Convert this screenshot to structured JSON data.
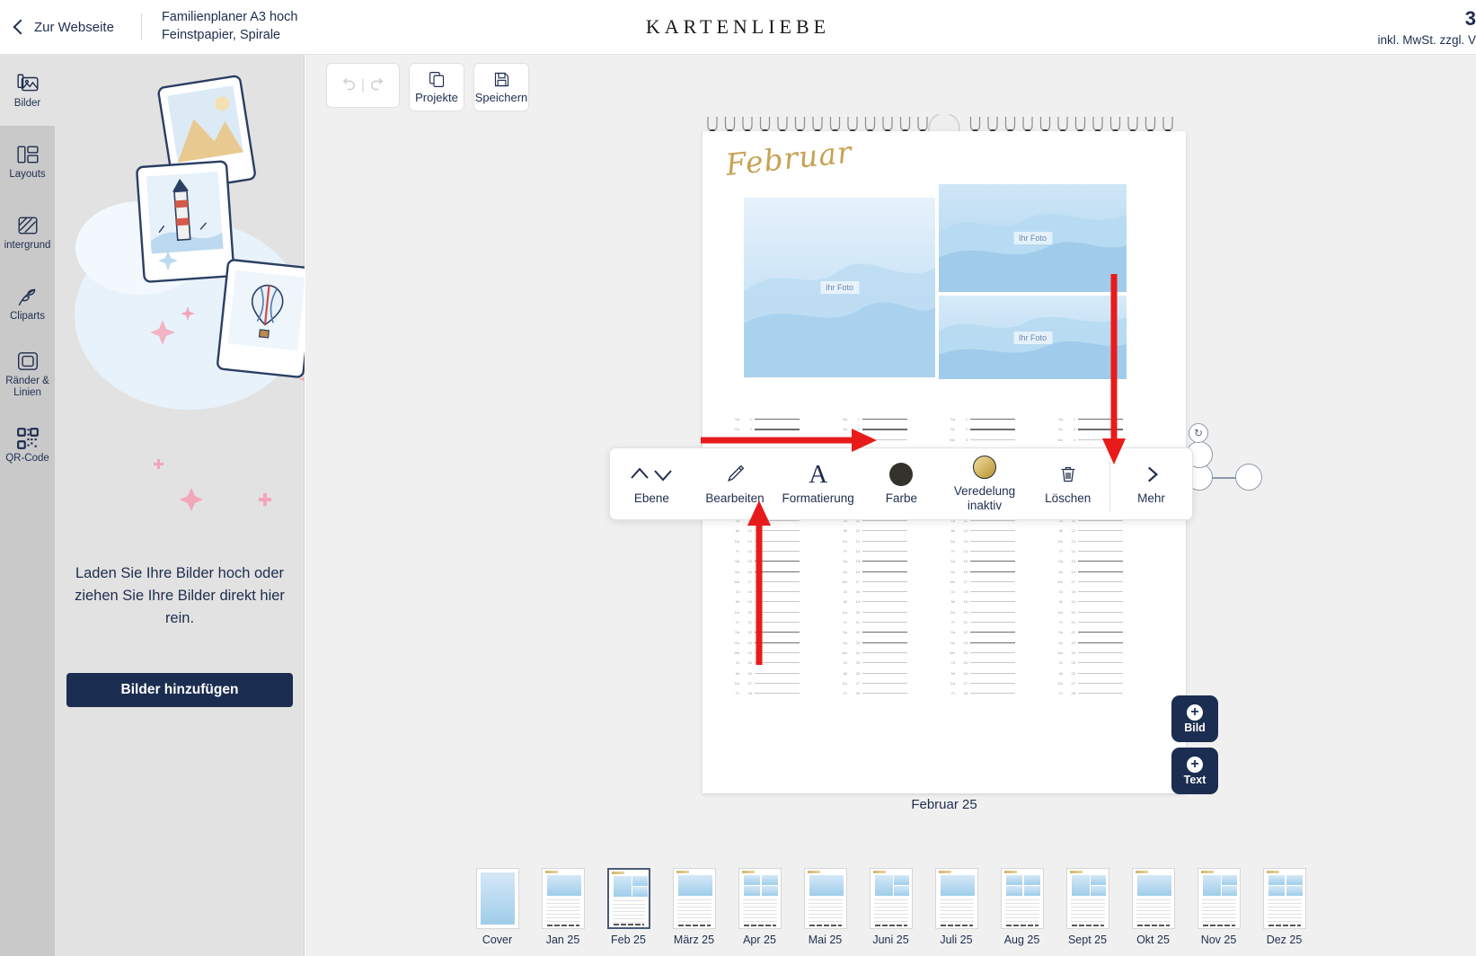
{
  "header": {
    "back_label": "Zur Webseite",
    "product_title": "Familienplaner A3 hoch",
    "product_sub": "Feinstpapier, Spirale",
    "brand": "KARTENLIEBE",
    "price": "3",
    "price_note": "inkl. MwSt. zzgl. V"
  },
  "sidebar": {
    "items": [
      {
        "label": "Bilder",
        "icon": "image-icon",
        "active": true
      },
      {
        "label": "Layouts",
        "icon": "layouts-icon",
        "active": false
      },
      {
        "label": "intergrund",
        "icon": "background-icon",
        "active": false
      },
      {
        "label": "Cliparts",
        "icon": "clipart-icon",
        "active": false
      },
      {
        "label": "Ränder &\nLinien",
        "icon": "borders-icon",
        "active": false
      },
      {
        "label": "QR-Code",
        "icon": "qrcode-icon",
        "active": false
      }
    ]
  },
  "panel": {
    "dropzone_text": "Laden Sie Ihre Bilder hoch oder ziehen Sie Ihre Bilder direkt hier rein.",
    "add_button": "Bilder hinzufügen"
  },
  "toolbar": {
    "undo": "undo-icon",
    "redo": "redo-icon",
    "projects_label": "Projekte",
    "save_label": "Speichern"
  },
  "canvas": {
    "month_title": "Februar",
    "page_caption": "Februar 25",
    "photo_placeholder": "Ihr Foto",
    "photo_count": 3,
    "fab_image": "Bild",
    "fab_text": "Text"
  },
  "context_menu": {
    "items": [
      {
        "name": "ebene",
        "label": "Ebene",
        "icon": "chevron-up-down-icon"
      },
      {
        "name": "bearbeiten",
        "label": "Bearbeiten",
        "icon": "pencil-icon"
      },
      {
        "name": "formatierung",
        "label": "Formatierung",
        "icon": "letter-a-icon"
      },
      {
        "name": "farbe",
        "label": "Farbe",
        "icon": "color-swatch-dark"
      },
      {
        "name": "veredelung",
        "label": "Veredelung",
        "sublabel": "inaktiv",
        "icon": "color-swatch-gold"
      },
      {
        "name": "loeschen",
        "label": "Löschen",
        "icon": "trash-icon"
      },
      {
        "name": "mehr",
        "label": "Mehr",
        "icon": "chevron-right-icon"
      }
    ]
  },
  "thumbnails": {
    "selected_index": 2,
    "items": [
      {
        "label": "Cover",
        "layout": "cover"
      },
      {
        "label": "Jan 25",
        "layout": "one"
      },
      {
        "label": "Feb 25",
        "layout": "split"
      },
      {
        "label": "März 25",
        "layout": "one"
      },
      {
        "label": "Apr 25",
        "layout": "four"
      },
      {
        "label": "Mai 25",
        "layout": "one"
      },
      {
        "label": "Juni 25",
        "layout": "split"
      },
      {
        "label": "Juli 25",
        "layout": "one"
      },
      {
        "label": "Aug 25",
        "layout": "four"
      },
      {
        "label": "Sept 25",
        "layout": "split"
      },
      {
        "label": "Okt 25",
        "layout": "one"
      },
      {
        "label": "Nov 25",
        "layout": "split"
      },
      {
        "label": "Dez 25",
        "layout": "four"
      }
    ]
  },
  "calendar_grid": {
    "day_abbrev": [
      "Sa",
      "So",
      "Mo",
      "Di",
      "Mi",
      "Do",
      "Fr"
    ],
    "columns": 4,
    "rows_per_column": 28,
    "weekend_marks": [
      0,
      1
    ]
  },
  "colors": {
    "brand_navy": "#1b2d50",
    "rail_bg": "#c9c9c9",
    "panel_bg": "#e2e2e2",
    "workspace_bg": "#f0f0f0",
    "gold": "#c6a354",
    "annotation_red": "#e81b1b"
  }
}
